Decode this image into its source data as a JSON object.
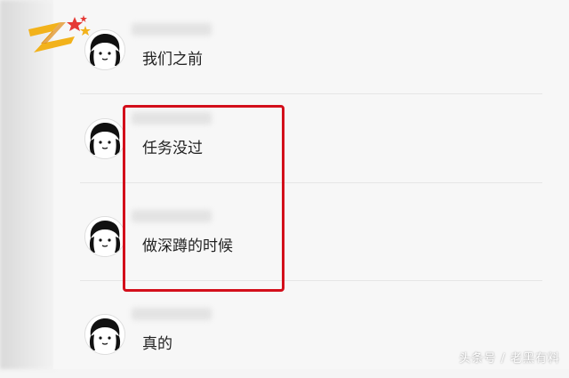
{
  "messages": [
    {
      "text": "我们之前"
    },
    {
      "text": "任务没过"
    },
    {
      "text": "做深蹲的时候"
    },
    {
      "text": "真的"
    }
  ],
  "watermark": "头条号 / 老黑有料",
  "colors": {
    "highlight": "#d30f1b",
    "panel": "#f7f7f7"
  },
  "icons": {
    "logo": "channel-logo-icon",
    "avatar": "cartoon-avatar-icon"
  }
}
